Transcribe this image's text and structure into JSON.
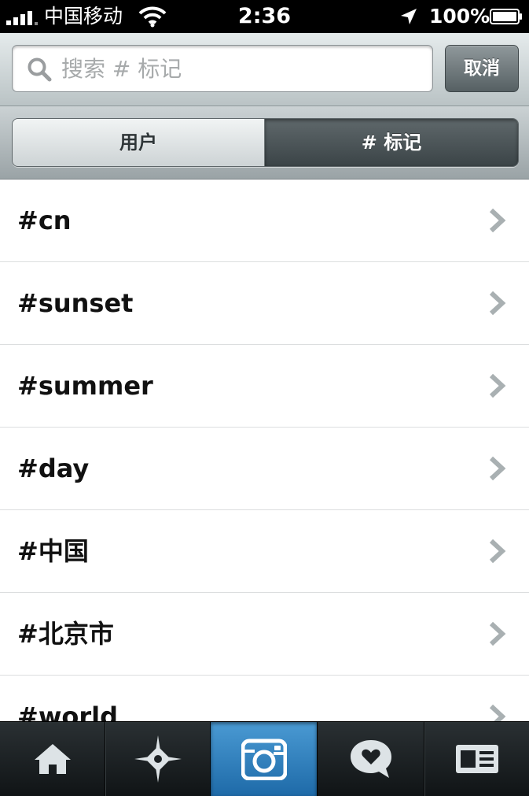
{
  "status_bar": {
    "carrier": "中国移动",
    "time": "2:36",
    "battery_percent": "100%",
    "signal_bars": 4
  },
  "search": {
    "placeholder": "搜索 # 标记",
    "value": "",
    "cancel_label": "取消"
  },
  "segments": {
    "users_label": "用户",
    "tags_label": "# 标记",
    "selected": "tags"
  },
  "tags": [
    {
      "label": "#cn"
    },
    {
      "label": "#sunset"
    },
    {
      "label": "#summer"
    },
    {
      "label": "#day"
    },
    {
      "label": "#中国"
    },
    {
      "label": "#北京市"
    },
    {
      "label": "#world"
    }
  ],
  "tab_bar": {
    "tabs": [
      {
        "icon": "home-icon"
      },
      {
        "icon": "explore-star-icon"
      },
      {
        "icon": "camera-icon",
        "active": true
      },
      {
        "icon": "news-heart-bubble-icon"
      },
      {
        "icon": "profile-card-icon"
      }
    ]
  },
  "colors": {
    "active_tab": "#2e7fbf",
    "selected_segment": "#4c5558",
    "row_divider": "#dcdedf"
  }
}
